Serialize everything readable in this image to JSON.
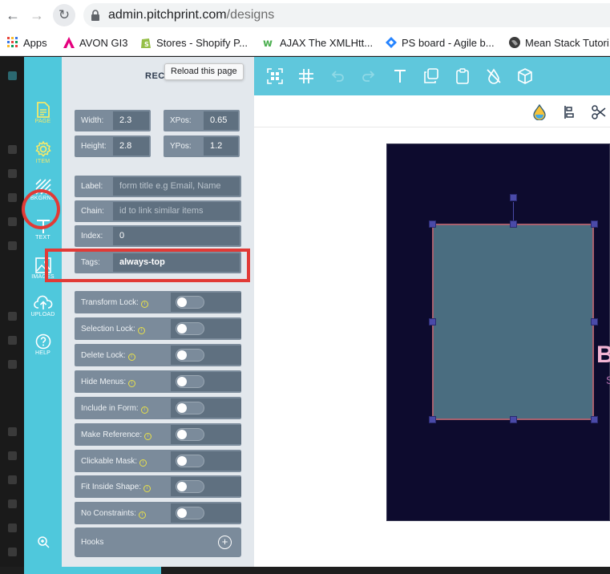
{
  "browser": {
    "url_domain": "admin.pitchprint.com",
    "url_path": "/designs",
    "tooltip": "Reload this page"
  },
  "bookmarks": [
    {
      "label": "Apps",
      "icon": "apps-grid-icon",
      "color": "#e8453c"
    },
    {
      "label": "AVON GI3",
      "icon": "avon-icon",
      "color": "#e5007e"
    },
    {
      "label": "Stores - Shopify P...",
      "icon": "shopify-icon",
      "color": "#95bf47"
    },
    {
      "label": "AJAX The XMLHtt...",
      "icon": "w3schools-icon",
      "color": "#4caf50"
    },
    {
      "label": "PS board - Agile b...",
      "icon": "jira-icon",
      "color": "#2684ff"
    },
    {
      "label": "Mean Stack Tutori...",
      "icon": "globe-icon",
      "color": "#202124"
    }
  ],
  "tools": [
    {
      "label": "PAGE",
      "icon": "page-icon",
      "active": true
    },
    {
      "label": "ITEM",
      "icon": "gear-icon",
      "active": true
    },
    {
      "label": "BKGRND",
      "icon": "background-icon",
      "active": false
    },
    {
      "label": "TEXT",
      "icon": "text-icon",
      "active": false
    },
    {
      "label": "IMAGES",
      "icon": "image-icon",
      "active": false
    },
    {
      "label": "UPLOAD",
      "icon": "upload-icon",
      "active": false
    },
    {
      "label": "HELP",
      "icon": "help-icon",
      "active": false
    }
  ],
  "panel": {
    "title": "RECT",
    "width_label": "Width:",
    "width_value": "2.3",
    "xpos_label": "XPos:",
    "xpos_value": "0.65",
    "height_label": "Height:",
    "height_value": "2.8",
    "ypos_label": "YPos:",
    "ypos_value": "1.2",
    "label_label": "Label:",
    "label_placeholder": "form title e.g Email, Name",
    "chain_label": "Chain:",
    "chain_placeholder": "id to link similar items",
    "index_label": "Index:",
    "index_value": "0",
    "tags_label": "Tags:",
    "tags_value": "always-top",
    "locks": [
      {
        "label": "Transform Lock:",
        "on": false
      },
      {
        "label": "Selection Lock:",
        "on": false
      },
      {
        "label": "Delete Lock:",
        "on": false
      },
      {
        "label": "Hide Menus:",
        "on": false
      },
      {
        "label": "Include in Form:",
        "on": false
      },
      {
        "label": "Make Reference:",
        "on": false
      },
      {
        "label": "Clickable Mask:",
        "on": false
      },
      {
        "label": "Fit Inside Shape:",
        "on": false
      },
      {
        "label": "No Constraints:",
        "on": false
      }
    ],
    "hooks_label": "Hooks"
  },
  "toolbar": {
    "icons": [
      "qr-code-icon",
      "grid-hash-icon",
      "undo-icon",
      "redo-icon",
      "text-icon",
      "duplicate-icon",
      "clipboard-icon",
      "no-fill-icon",
      "3d-box-icon"
    ]
  },
  "subbar": {
    "icons": [
      "color-drop-icon",
      "align-icon",
      "scissors-icon"
    ]
  },
  "canvas": {
    "text_big": "B",
    "text_small": "S"
  },
  "colors": {
    "accent": "#4fc8dc",
    "active_tool": "#f4e96a",
    "highlight": "#e13a36",
    "canvas_bg": "#0d0b2e"
  }
}
